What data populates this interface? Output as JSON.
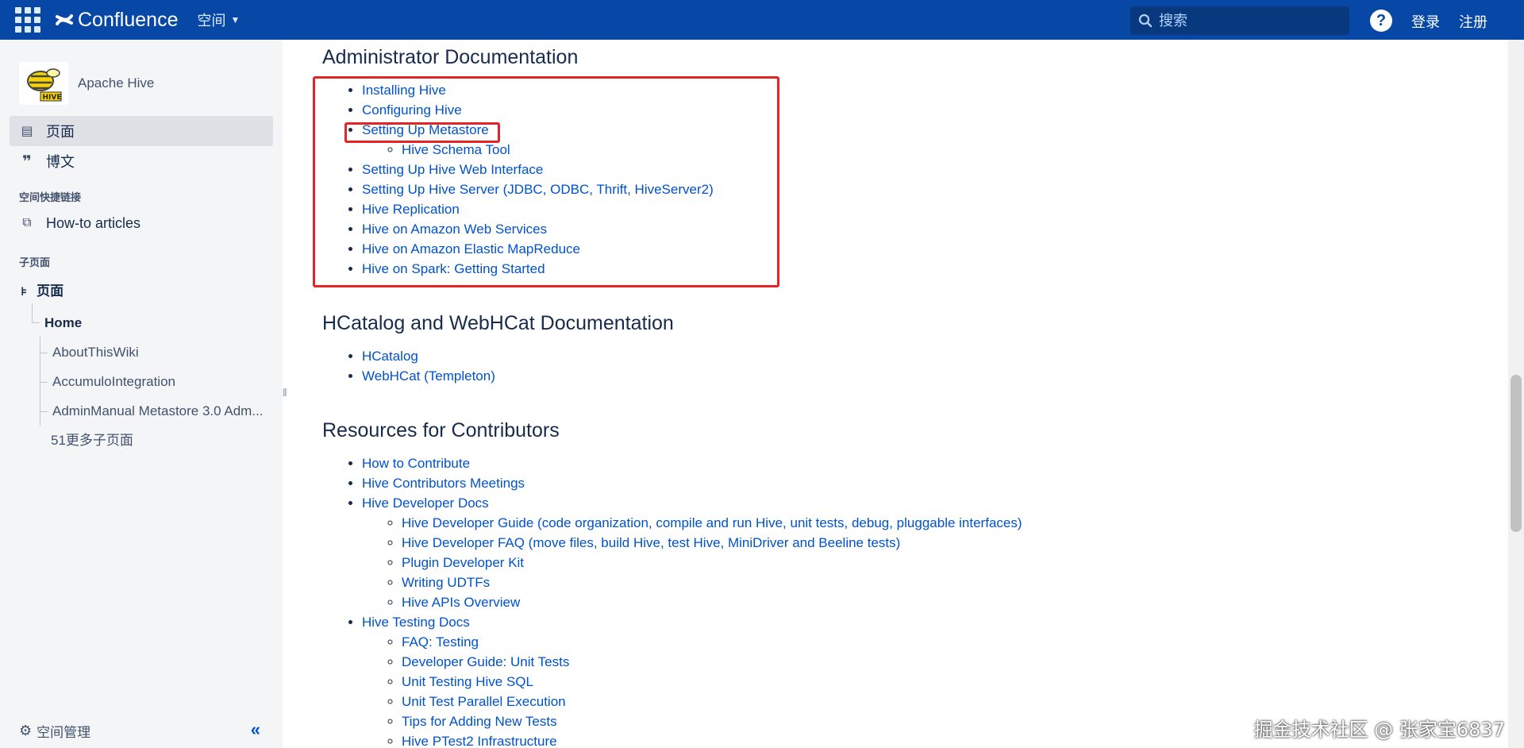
{
  "header": {
    "brand": "Confluence",
    "space_menu": "空间",
    "search_placeholder": "搜索",
    "help": "?",
    "login": "登录",
    "register": "注册"
  },
  "sidebar": {
    "space_name": "Apache Hive",
    "nav": [
      {
        "label": "页面",
        "icon": "page-icon"
      },
      {
        "label": "博文",
        "icon": "quote-icon"
      }
    ],
    "shortcuts_title": "空间快捷链接",
    "shortcuts": [
      {
        "label": "How-to articles",
        "icon": "copy-icon"
      }
    ],
    "children_title": "子页面",
    "tree_root": "页面",
    "tree_home": "Home",
    "tree_children": [
      "AboutThisWiki",
      "AccumuloIntegration",
      "AdminManual Metastore 3.0 Adm..."
    ],
    "more_children": "51更多子页面",
    "footer": "空间管理",
    "collapse": "«"
  },
  "content": {
    "admin_title": "Administrator Documentation",
    "admin_links": [
      {
        "label": "Installing Hive",
        "children": []
      },
      {
        "label": "Configuring Hive",
        "children": []
      },
      {
        "label": "Setting Up Metastore",
        "children": [
          "Hive Schema Tool"
        ]
      },
      {
        "label": "Setting Up Hive Web Interface",
        "children": []
      },
      {
        "label": "Setting Up Hive Server",
        "suffix": " (JDBC, ODBC, Thrift, HiveServer2)",
        "children": []
      },
      {
        "label": "Hive Replication",
        "children": []
      },
      {
        "label": "Hive on Amazon Web Services",
        "children": []
      },
      {
        "label": "Hive on Amazon Elastic MapReduce",
        "children": []
      },
      {
        "label": "Hive on Spark: Getting Started",
        "children": []
      }
    ],
    "hcat_title": "HCatalog and WebHCat Documentation",
    "hcat_links": [
      {
        "label": "HCatalog"
      },
      {
        "label": "WebHCat (Templeton)"
      }
    ],
    "contrib_title": "Resources for Contributors",
    "contrib_links": [
      {
        "label": "How to Contribute",
        "children": []
      },
      {
        "label": "Hive Contributors Meetings",
        "children": []
      },
      {
        "label": "Hive Developer Docs",
        "children": [
          {
            "label": "Hive Developer Guide",
            "suffix": " (code organization, compile and run Hive, unit tests, debug, pluggable interfaces)"
          },
          {
            "label": "Hive Developer FAQ",
            "suffix": " (move files, build Hive, test Hive, MiniDriver and Beeline tests)"
          },
          {
            "label": "Plugin Developer Kit"
          },
          {
            "label": "Writing UDTFs"
          },
          {
            "label": "Hive APIs Overview"
          }
        ]
      },
      {
        "label": "Hive Testing Docs",
        "children": [
          {
            "label": "FAQ: Testing"
          },
          {
            "label": "Developer Guide: Unit Tests"
          },
          {
            "label": "Unit Testing Hive SQL"
          },
          {
            "label": "Unit Test Parallel Execution"
          },
          {
            "label": "Tips for Adding New Tests"
          },
          {
            "label": "Hive PTest2 Infrastructure"
          }
        ]
      }
    ]
  },
  "watermark": "掘金技术社区 @ 张家宝6837",
  "colors": {
    "header_bg": "#0747a6",
    "link": "#0052cc",
    "highlight_box": "#e32525",
    "sidebar_bg": "#f4f5f7"
  }
}
